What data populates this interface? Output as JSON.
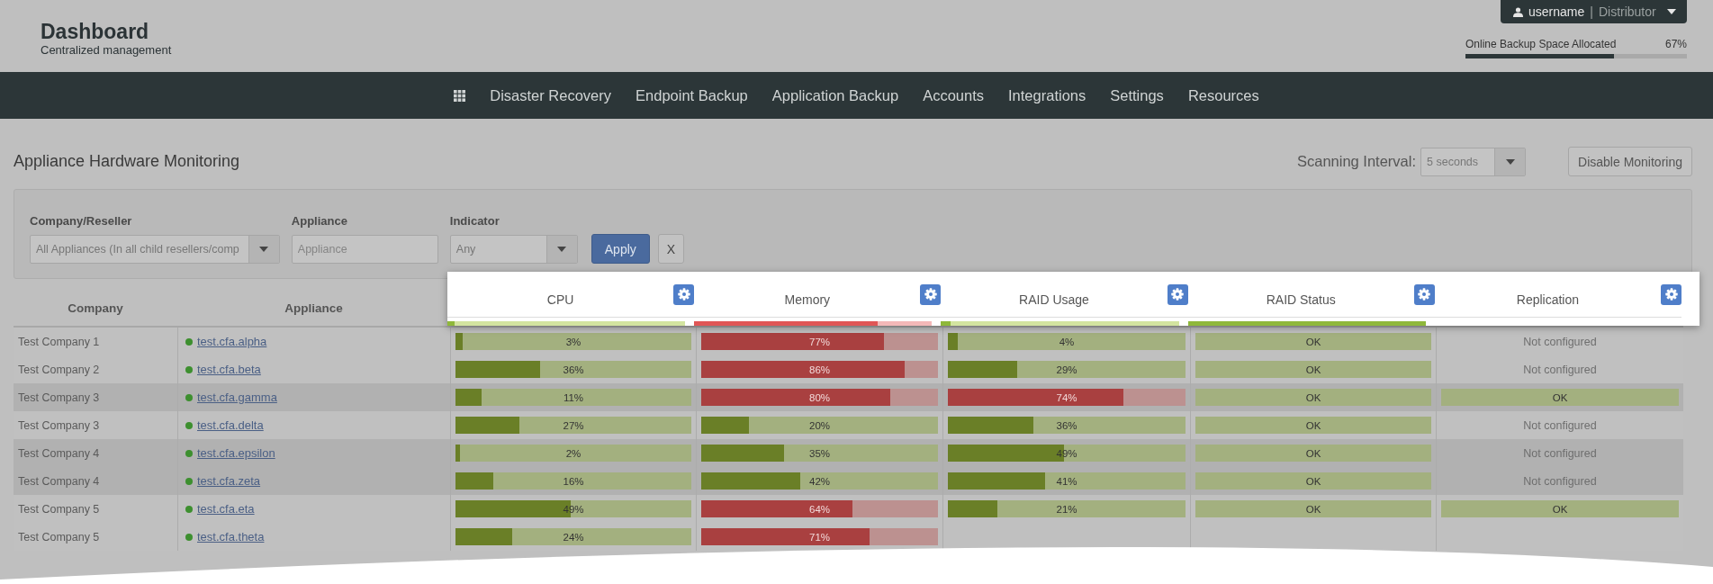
{
  "header": {
    "title": "Dashboard",
    "subtitle": "Centralized management",
    "user": {
      "name": "username",
      "separator": "|",
      "role": "Distributor"
    },
    "backup": {
      "label": "Online Backup Space Allocated",
      "reading": "67%",
      "level": 0.67
    }
  },
  "nav": {
    "items": [
      "Disaster Recovery",
      "Endpoint Backup",
      "Application Backup",
      "Accounts",
      "Integrations",
      "Settings",
      "Resources"
    ]
  },
  "page": {
    "title": "Appliance Hardware Monitoring",
    "scanning_label": "Scanning Interval:",
    "scanning_value": "5 seconds",
    "disable_button": "Disable Monitoring"
  },
  "filters": {
    "fields": [
      {
        "kind": "select",
        "label": "Company/Reseller",
        "value": "All Appliances (In all child resellers/comp"
      },
      {
        "kind": "input",
        "label": "Appliance",
        "placeholder": "Appliance"
      },
      {
        "kind": "select",
        "label": "Indicator",
        "value": "Any"
      }
    ],
    "apply": "Apply",
    "clear": "X"
  },
  "table": {
    "columns": [
      "Company",
      "Appliance"
    ],
    "rows": [
      {
        "company": "Test Company 1",
        "appliance": "test.cfa.alpha",
        "color": "#3d8f2f",
        "shaded": false,
        "cpu": {
          "level": 0.03,
          "reading": "3%",
          "alert": false
        },
        "memory": {
          "level": 0.77,
          "reading": "77%",
          "alert": true
        },
        "raid_usage": {
          "level": 0.04,
          "reading": "4%",
          "alert": false
        },
        "raid_status": {
          "kind": "bar",
          "text": "OK"
        },
        "replication": {
          "kind": "text",
          "text": "Not configured"
        }
      },
      {
        "company": "Test Company 2",
        "appliance": "test.cfa.beta",
        "color": "#3d8f2f",
        "shaded": false,
        "cpu": {
          "level": 0.36,
          "reading": "36%",
          "alert": false
        },
        "memory": {
          "level": 0.86,
          "reading": "86%",
          "alert": true
        },
        "raid_usage": {
          "level": 0.29,
          "reading": "29%",
          "alert": false
        },
        "raid_status": {
          "kind": "bar",
          "text": "OK"
        },
        "replication": {
          "kind": "text",
          "text": "Not configured"
        }
      },
      {
        "company": "Test Company 3",
        "appliance": "test.cfa.gamma",
        "color": "#3d8f2f",
        "shaded": true,
        "cpu": {
          "level": 0.11,
          "reading": "11%",
          "alert": false
        },
        "memory": {
          "level": 0.8,
          "reading": "80%",
          "alert": true
        },
        "raid_usage": {
          "level": 0.74,
          "reading": "74%",
          "alert": true
        },
        "raid_status": {
          "kind": "bar",
          "text": "OK"
        },
        "replication": {
          "kind": "bar",
          "text": "OK"
        }
      },
      {
        "company": "Test Company 3",
        "appliance": "test.cfa.delta",
        "color": "#3d8f2f",
        "shaded": false,
        "cpu": {
          "level": 0.27,
          "reading": "27%",
          "alert": false
        },
        "memory": {
          "level": 0.2,
          "reading": "20%",
          "alert": false
        },
        "raid_usage": {
          "level": 0.36,
          "reading": "36%",
          "alert": false
        },
        "raid_status": {
          "kind": "bar",
          "text": "OK"
        },
        "replication": {
          "kind": "text",
          "text": "Not configured"
        }
      },
      {
        "company": "Test Company 4",
        "appliance": "test.cfa.epsilon",
        "color": "#3d8f2f",
        "shaded": true,
        "cpu": {
          "level": 0.02,
          "reading": "2%",
          "alert": false
        },
        "memory": {
          "level": 0.35,
          "reading": "35%",
          "alert": false
        },
        "raid_usage": {
          "level": 0.49,
          "reading": "49%",
          "alert": false
        },
        "raid_status": {
          "kind": "bar",
          "text": "OK"
        },
        "replication": {
          "kind": "text",
          "text": "Not configured"
        }
      },
      {
        "company": "Test Company 4",
        "appliance": "test.cfa.zeta",
        "color": "#3d8f2f",
        "shaded": true,
        "cpu": {
          "level": 0.16,
          "reading": "16%",
          "alert": false
        },
        "memory": {
          "level": 0.42,
          "reading": "42%",
          "alert": false
        },
        "raid_usage": {
          "level": 0.41,
          "reading": "41%",
          "alert": false
        },
        "raid_status": {
          "kind": "bar",
          "text": "OK"
        },
        "replication": {
          "kind": "text",
          "text": "Not configured"
        }
      },
      {
        "company": "Test Company 5",
        "appliance": "test.cfa.eta",
        "color": "#3d8f2f",
        "shaded": false,
        "cpu": {
          "level": 0.49,
          "reading": "49%",
          "alert": false
        },
        "memory": {
          "level": 0.64,
          "reading": "64%",
          "alert": true
        },
        "raid_usage": {
          "level": 0.21,
          "reading": "21%",
          "alert": false
        },
        "raid_status": {
          "kind": "bar",
          "text": "OK"
        },
        "replication": {
          "kind": "bar",
          "text": "OK"
        }
      },
      {
        "company": "Test Company 5",
        "appliance": "test.cfa.theta",
        "color": "#3d8f2f",
        "shaded": false,
        "cpu": {
          "level": 0.24,
          "reading": "24%",
          "alert": false
        },
        "memory": {
          "level": 0.71,
          "reading": "71%",
          "alert": true
        }
      }
    ]
  },
  "column_popup": {
    "columns": [
      "CPU",
      "Memory",
      "RAID Usage",
      "RAID Status",
      "Replication"
    ]
  }
}
